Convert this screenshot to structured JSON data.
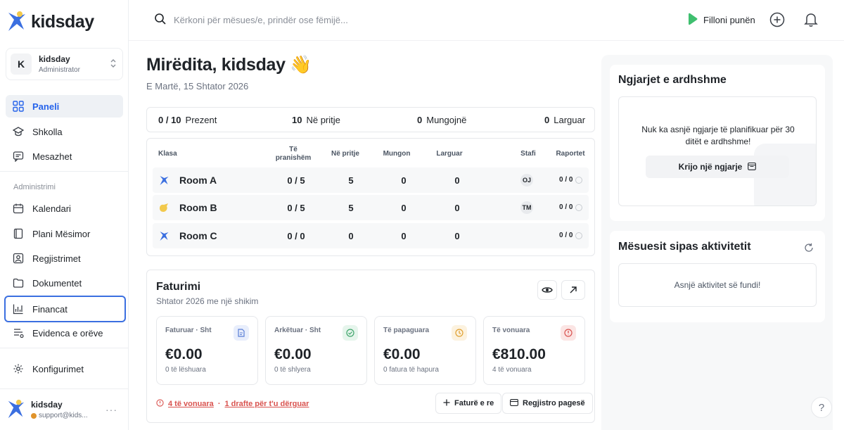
{
  "app": {
    "brand": "kidsday"
  },
  "org": {
    "avatar": "K",
    "name": "kidsday",
    "role": "Administrator"
  },
  "sidebar": {
    "items_top": [
      {
        "label": "Paneli",
        "icon": "dashboard-icon",
        "active": true
      },
      {
        "label": "Shkolla",
        "icon": "school-icon"
      },
      {
        "label": "Mesazhet",
        "icon": "message-icon"
      }
    ],
    "section_label": "Administrimi",
    "items_admin": [
      {
        "label": "Kalendari",
        "icon": "calendar-icon"
      },
      {
        "label": "Plani Mësimor",
        "icon": "book-icon"
      },
      {
        "label": "Regjistrimet",
        "icon": "registration-icon"
      },
      {
        "label": "Dokumentet",
        "icon": "folder-icon"
      },
      {
        "label": "Financat",
        "icon": "finance-icon",
        "focused": true
      },
      {
        "label": "Evidenca e orëve",
        "icon": "timesheet-icon"
      }
    ],
    "settings": {
      "label": "Konfigurimet",
      "icon": "gear-icon"
    }
  },
  "user": {
    "name": "kidsday",
    "email": "support@kids..."
  },
  "topbar": {
    "search_placeholder": "Kërkoni për mësues/e, prindër ose fëmijë...",
    "start_work": "Filloni punën"
  },
  "main": {
    "greeting": "Mirëdita, kidsday 👋",
    "date": "E Martë, 15 Shtator 2026"
  },
  "stats": {
    "present": {
      "value": "0 / 10",
      "label": "Prezent"
    },
    "waiting": {
      "value": "10",
      "label": "Në pritje"
    },
    "absent": {
      "value": "0",
      "label": "Mungojnë"
    },
    "left": {
      "value": "0",
      "label": "Larguar"
    }
  },
  "rooms": {
    "headers": {
      "class": "Klasa",
      "present_1": "Të",
      "present_2": "pranishëm",
      "waiting": "Në pritje",
      "absent": "Mungon",
      "left": "Larguar",
      "staff": "Stafi",
      "reports": "Raportet"
    },
    "rows": [
      {
        "name": "Room A",
        "present": "0 / 5",
        "waiting": "5",
        "absent": "0",
        "left": "0",
        "staff": "OJ",
        "reports": "0 / 0",
        "color": "#3b6fe0"
      },
      {
        "name": "Room B",
        "present": "0 / 5",
        "waiting": "5",
        "absent": "0",
        "left": "0",
        "staff": "TM",
        "reports": "0 / 0",
        "color": "#f2c94c"
      },
      {
        "name": "Room C",
        "present": "0 / 0",
        "waiting": "0",
        "absent": "0",
        "left": "0",
        "staff": "",
        "reports": "0 / 0",
        "color": "#3b6fe0"
      }
    ]
  },
  "billing": {
    "title": "Faturimi",
    "subtitle": "Shtator 2026 me një shikim",
    "kpis": [
      {
        "label": "Faturuar · Sht",
        "value": "€0.00",
        "sub": "0 të lëshuara",
        "icon": "invoice-icon",
        "color": "#5b7fd6",
        "bg": "#e8eefc"
      },
      {
        "label": "Arkëtuar · Sht",
        "value": "€0.00",
        "sub": "0 të shlyera",
        "icon": "check-circle-icon",
        "color": "#3fa56b",
        "bg": "#e6f5ec"
      },
      {
        "label": "Të papaguara",
        "value": "€0.00",
        "sub": "0 fatura të hapura",
        "icon": "clock-icon",
        "color": "#e0a030",
        "bg": "#fcf2df"
      },
      {
        "label": "Të vonuara",
        "value": "€810.00",
        "sub": "4 të vonuara",
        "icon": "alert-icon",
        "color": "#d9534f",
        "bg": "#fbe5e4"
      }
    ],
    "note_overdue": "4 të vonuara",
    "note_sep": "·",
    "note_drafts": "1 drafte për t'u dërguar",
    "new_invoice": "Faturë e re",
    "record_payment": "Regjistro pagesë"
  },
  "events": {
    "title": "Ngjarjet e ardhshme",
    "empty": "Nuk ka asnjë ngjarje të planifikuar për 30 ditët e ardhshme!",
    "create": "Krijo një ngjarje"
  },
  "activity": {
    "title": "Mësuesit sipas aktivitetit",
    "empty": "Asnjë aktivitet së fundi!"
  },
  "help": "?"
}
